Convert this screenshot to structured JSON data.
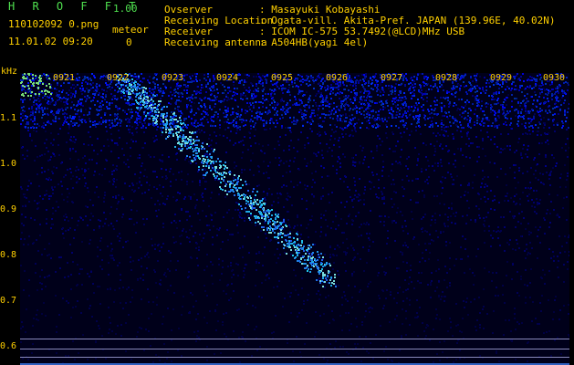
{
  "app": {
    "title": "H R O F F T",
    "version": "1.00"
  },
  "file_name": "110102092 0.png",
  "datetime": "11.01.02 09:20",
  "meteor": {
    "label": "meteor",
    "count": "0"
  },
  "info": [
    {
      "key": "Ovserver",
      "value": ": Masayuki Kobayashi"
    },
    {
      "key": "Receiving Location",
      "value": ": Ogata-vill. Akita-Pref. JAPAN (139.96E, 40.02N)"
    },
    {
      "key": "Receiver",
      "value": ": ICOM IC-575 53.7492(@LCD)MHz USB"
    },
    {
      "key": "Receiving antenna",
      "value": ": A504HB(yagi 4el)"
    }
  ],
  "y_axis": {
    "unit": "kHz",
    "ticks": [
      "1.1",
      "1.0",
      "0.9",
      "0.8",
      "0.7",
      "0.6"
    ]
  },
  "x_axis": {
    "ticks": [
      "0921",
      "0922",
      "0923",
      "0924",
      "0925",
      "0926",
      "0927",
      "0928",
      "0929",
      "0930"
    ]
  },
  "colors": {
    "text": "#ffd000",
    "title": "#4fe04f",
    "background": "#000000",
    "plot_bg": "#00001a"
  }
}
